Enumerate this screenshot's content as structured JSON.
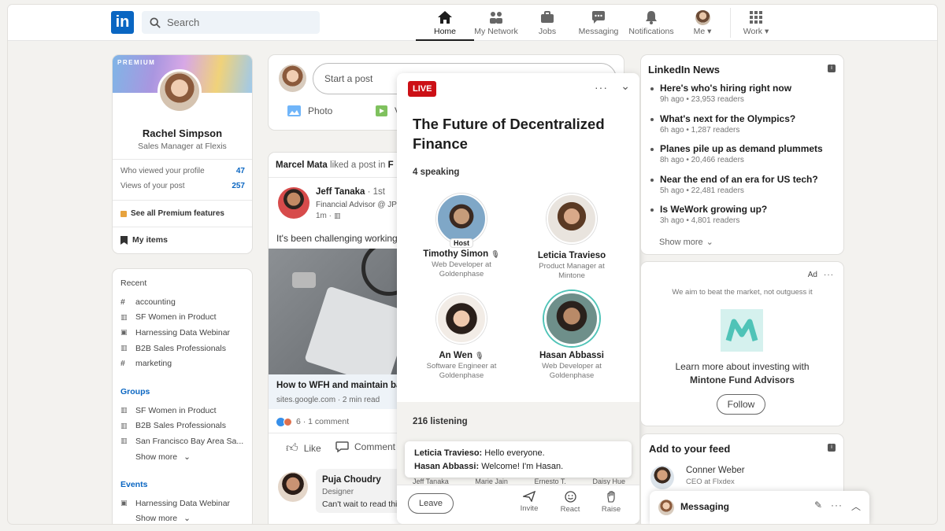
{
  "header": {
    "logo": "in",
    "search_placeholder": "Search",
    "nav": [
      {
        "label": "Home",
        "icon": "home-icon"
      },
      {
        "label": "My Network",
        "icon": "network-icon"
      },
      {
        "label": "Jobs",
        "icon": "jobs-icon"
      },
      {
        "label": "Messaging",
        "icon": "messaging-icon"
      },
      {
        "label": "Notifications",
        "icon": "bell-icon"
      },
      {
        "label": "Me ▾",
        "icon": "me-avatar"
      },
      {
        "label": "Work ▾",
        "icon": "grid-icon"
      }
    ]
  },
  "profile": {
    "premium": "PREMIUM",
    "name": "Rachel Simpson",
    "title": "Sales Manager at Flexis",
    "stats": [
      {
        "label": "Who viewed your profile",
        "value": "47"
      },
      {
        "label": "Views of your post",
        "value": "257"
      }
    ],
    "premium_link": "See all Premium features",
    "my_items": "My items"
  },
  "recent": {
    "heading": "Recent",
    "items": [
      "accounting",
      "SF Women in Product",
      "Harnessing Data Webinar",
      "B2B Sales Professionals",
      "marketing"
    ],
    "groups_heading": "Groups",
    "groups": [
      "SF Women in Product",
      "B2B Sales Professionals",
      "San Francisco Bay Area Sa..."
    ],
    "show_more": "Show more",
    "events_heading": "Events",
    "events": [
      "Harnessing Data Webinar"
    ]
  },
  "composer": {
    "placeholder": "Start a post",
    "photo": "Photo",
    "video_initial": "V"
  },
  "feed": {
    "actor": "Marcel Mata",
    "action": "liked a post in",
    "action_tail": "F",
    "author": "Jeff Tanaka",
    "degree": "· 1st",
    "author_title": "Financial Advisor @ JP",
    "time": "1m ·",
    "text": "It's been challenging working",
    "link_title": "How to WFH and maintain ba",
    "link_source": "sites.google.com · 2 min read",
    "reactions": "6 · 1 comment",
    "like": "Like",
    "comment": "Comment",
    "commenter": "Puja Choudry",
    "commenter_title": "Designer",
    "comment_text": "Can't wait to read thi"
  },
  "live": {
    "badge": "LIVE",
    "title": "The Future of Decentralized Finance",
    "speaking": "4 speaking",
    "speakers": [
      {
        "name": "Timothy Simon",
        "title": "Web Developer at Goldenphase",
        "host": "Host"
      },
      {
        "name": "Leticia Travieso",
        "title": "Product Manager at Mintone",
        "host": ""
      },
      {
        "name": "An Wen",
        "title": "Software Engineer at Goldenphase",
        "host": ""
      },
      {
        "name": "Hasan Abbassi",
        "title": "Web Developer at Goldenphase",
        "host": ""
      }
    ],
    "listening": "216 listening",
    "chat": [
      {
        "who": "Leticia Travieso:",
        "msg": "Hello everyone."
      },
      {
        "who": "Hasan Abbassi:",
        "msg": "Welcome! I'm Hasan."
      }
    ],
    "listeners_peek": [
      "Jeff Tanaka",
      "Marie Jain",
      "Ernesto T.",
      "Daisy Hue"
    ],
    "leave": "Leave",
    "actions": [
      "Invite",
      "React",
      "Raise"
    ]
  },
  "news": {
    "heading": "LinkedIn News",
    "items": [
      {
        "title": "Here's who's hiring right now",
        "meta": "9h ago • 23,953 readers"
      },
      {
        "title": "What's next for the Olympics?",
        "meta": "6h ago • 1,287 readers"
      },
      {
        "title": "Planes pile up as demand plummets",
        "meta": "8h ago • 20,466 readers"
      },
      {
        "title": "Near the end of an era for US tech?",
        "meta": "5h ago • 22,481 readers"
      },
      {
        "title": "Is WeWork growing up?",
        "meta": "3h ago • 4,801 readers"
      }
    ],
    "show_more": "Show more"
  },
  "ad": {
    "label": "Ad",
    "tagline": "We aim to beat the market, not outguess it",
    "text": "Learn more about investing with",
    "company": "Mintone Fund Advisors",
    "follow": "Follow"
  },
  "feed_suggest": {
    "heading": "Add to your feed",
    "name": "Conner Weber",
    "title": "CEO at Flxdex"
  },
  "messaging": {
    "label": "Messaging"
  },
  "colors": {
    "brand": "#0a66c2",
    "live": "#cc1016",
    "ad_logo": "#4fc3b7"
  }
}
